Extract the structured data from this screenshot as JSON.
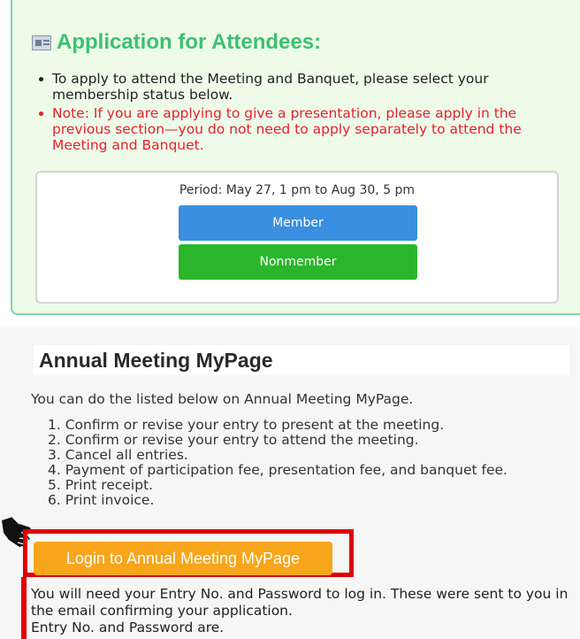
{
  "attendee_panel": {
    "icon": "attendee-card-icon",
    "title": "Application for Attendees:",
    "notes": [
      "To apply to attend the Meeting and Banquet, please select your membership status below.",
      "Note: If you are applying to give a presentation, please apply in the previous section—you do not need to apply separately to attend the Meeting and Banquet."
    ],
    "period": "Period: May 27, 1 pm to Aug 30, 5 pm",
    "member_button": "Member",
    "nonmember_button": "Nonmember"
  },
  "mypage": {
    "title": "Annual Meeting MyPage",
    "intro": "You can do the listed below on Annual Meeting MyPage.",
    "items": [
      "1. Confirm or revise your entry to present at the meeting.",
      "2. Confirm or revise your entry to attend the meeting.",
      "3. Cancel all entries.",
      "4. Payment of participation fee, presentation fee, and banquet fee.",
      "5. Print receipt.",
      "6. Print invoice."
    ],
    "login_button": "Login to Annual Meeting MyPage",
    "login_note_1": "You will need your Entry No. and Password to log in. These were sent to you in the email confirming your application.",
    "login_note_2": "Entry No. and Password are."
  },
  "colors": {
    "title_green": "#3cc170",
    "note_red": "#e8202a",
    "member_blue": "#3a8fe0",
    "nonmember_green": "#2bb52b",
    "login_orange": "#f7a51b",
    "highlight_red": "#e00000"
  }
}
